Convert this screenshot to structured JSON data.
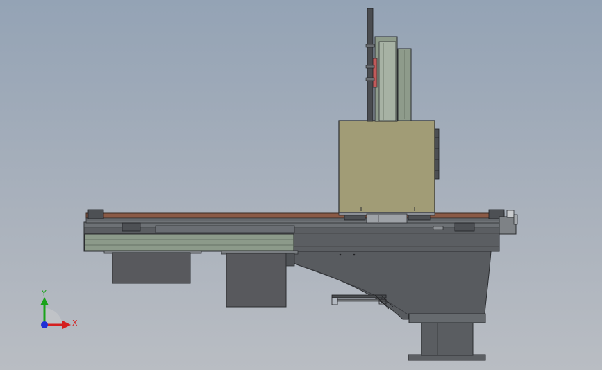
{
  "triad": {
    "y_label": "Y",
    "x_label": "X",
    "y_color": "#1aa31a",
    "x_color": "#d42020",
    "z_color": "#1f2fd6"
  },
  "colors": {
    "background": "#a9b1bc",
    "machine_dark": "#585b60",
    "machine_mid": "#6e7276",
    "panel_green": "#8c9a8a",
    "spindle_box": "#a19c76",
    "rail_wood": "#8a5a46",
    "accent_red": "#c25a5a"
  }
}
